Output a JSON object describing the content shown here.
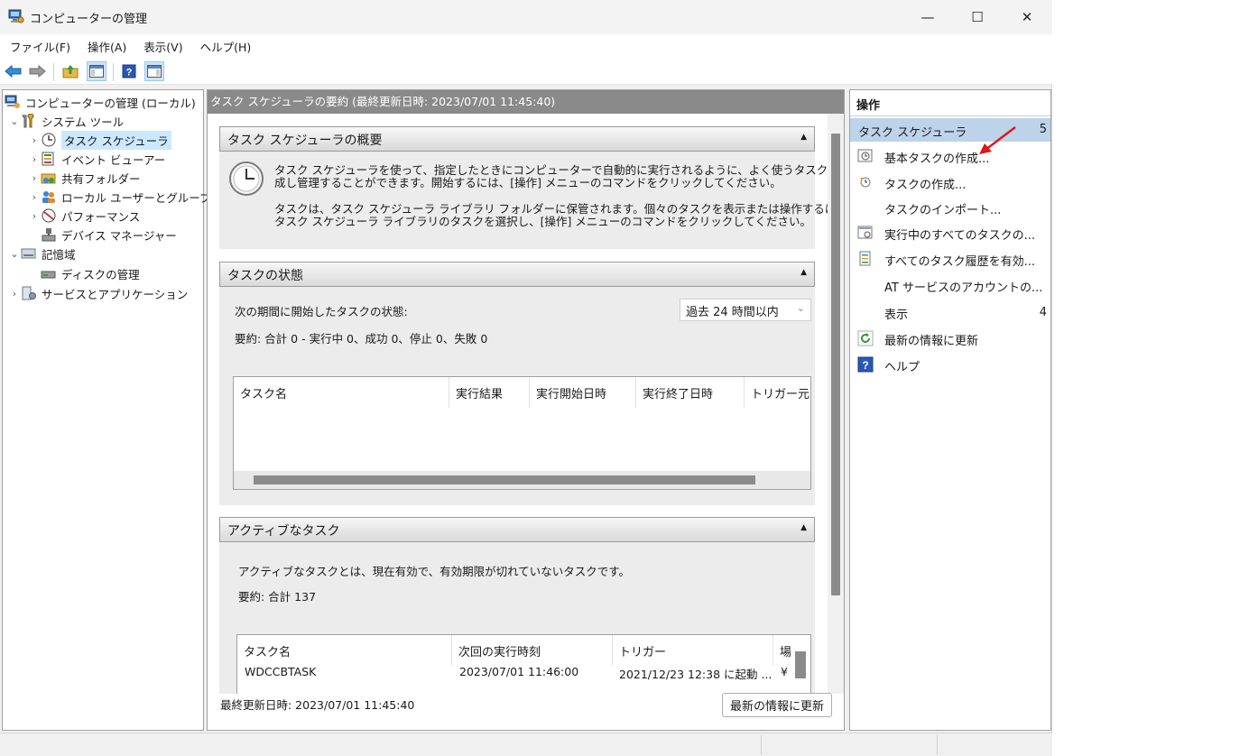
{
  "window": {
    "title": "コンピューターの管理",
    "minimize": "—",
    "maximize": "☐",
    "close": "✕"
  },
  "menu": [
    "ファイル(F)",
    "操作(A)",
    "表示(V)",
    "ヘルプ(H)"
  ],
  "toolbar": {
    "back_icon": "back-arrow-icon",
    "forward_icon": "forward-arrow-icon",
    "up_icon": "up-folder-icon",
    "console_tree_icon": "show-hide-tree-icon",
    "help_icon": "help-icon",
    "action_pane_icon": "show-hide-action-pane-icon"
  },
  "tree": {
    "root": "コンピューターの管理 (ローカル)",
    "system_tools": "システム ツール",
    "task_scheduler": "タスク スケジューラ",
    "event_viewer": "イベント ビューアー",
    "shared_folders": "共有フォルダー",
    "local_users": "ローカル ユーザーとグループ",
    "performance": "パフォーマンス",
    "device_manager": "デバイス マネージャー",
    "storage": "記憶域",
    "disk_management": "ディスクの管理",
    "services_apps": "サービスとアプリケーション"
  },
  "center": {
    "header": "タスク スケジューラの要約 (最終更新日時: 2023/07/01 11:45:40)",
    "overview": {
      "title": "タスク スケジューラの概要",
      "p1_line1": "タスク スケジューラを使って、指定したときにコンピューターで自動的に実行されるように、よく使うタスクを作",
      "p1_line2": "成し管理することができます。開始するには、[操作] メニューのコマンドをクリックしてください。",
      "p2_line1": "タスクは、タスク スケジューラ ライブラリ フォルダーに保管されます。個々のタスクを表示または操作するには、",
      "p2_line2": "タスク スケジューラ ライブラリのタスクを選択し、[操作] メニューのコマンドをクリックしてください。"
    },
    "status": {
      "title": "タスクの状態",
      "period_label": "次の期間に開始したタスクの状態:",
      "period_value": "過去 24 時間以内",
      "summary": "要約: 合計 0 - 実行中 0、成功 0、停止 0、失敗 0",
      "columns": [
        "タスク名",
        "実行結果",
        "実行開始日時",
        "実行終了日時",
        "トリガー元"
      ]
    },
    "active": {
      "title": "アクティブなタスク",
      "description": "アクティブなタスクとは、現在有効で、有効期限が切れていないタスクです。",
      "summary": "要約: 合計 137",
      "columns": [
        "タスク名",
        "次回の実行時刻",
        "トリガー",
        "場"
      ],
      "rows": [
        {
          "name": "WDCCBTASK",
          "next": "2023/07/01 11:46:00",
          "trigger": "2021/12/23 12:38 に起動 ...",
          "loc": "¥"
        }
      ]
    },
    "footer": {
      "last_updated": "最終更新日時: 2023/07/01 11:45:40",
      "refresh_button": "最新の情報に更新"
    }
  },
  "actions": {
    "header": "操作",
    "group": "タスク スケジューラ",
    "items": [
      "基本タスクの作成...",
      "タスクの作成...",
      "タスクのインポート...",
      "実行中のすべてのタスクの...",
      "すべてのタスク履歴を有効...",
      "AT サービスのアカウントの...",
      "表示",
      "最新の情報に更新",
      "ヘルプ"
    ],
    "group_arrow": "5",
    "view_arrow": "4"
  },
  "colors": {
    "accent": "#bcd3ea",
    "annotation_arrow": "#e0161b"
  }
}
